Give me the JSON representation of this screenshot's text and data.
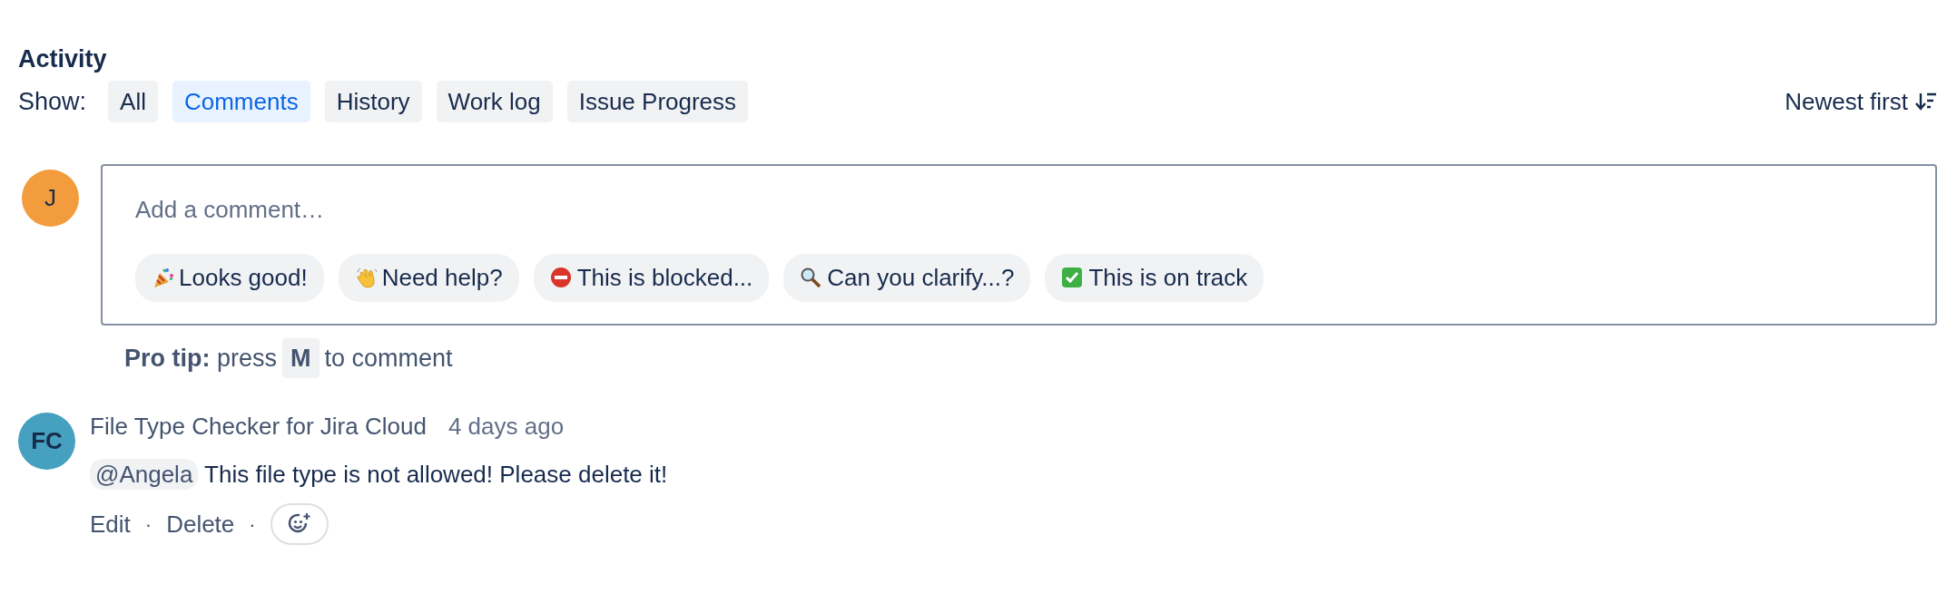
{
  "heading": "Activity",
  "filter": {
    "label": "Show:",
    "tabs": [
      {
        "label": "All",
        "selected": false
      },
      {
        "label": "Comments",
        "selected": true
      },
      {
        "label": "History",
        "selected": false
      },
      {
        "label": "Work log",
        "selected": false
      },
      {
        "label": "Issue Progress",
        "selected": false
      }
    ]
  },
  "sort": {
    "label": "Newest first"
  },
  "composer": {
    "avatar": "J",
    "placeholder": "Add a comment…",
    "quick_replies": [
      {
        "kind": "party",
        "label": "Looks good!"
      },
      {
        "kind": "wave",
        "label": "Need help?"
      },
      {
        "kind": "no-entry",
        "label": "This is blocked..."
      },
      {
        "kind": "magnifier",
        "label": "Can you clarify...?"
      },
      {
        "kind": "check",
        "label": "This is on track"
      }
    ]
  },
  "pro_tip": {
    "label": "Pro tip:",
    "before": "press",
    "key": "M",
    "after": "to comment"
  },
  "comments": [
    {
      "avatar": "FC",
      "author": "File Type Checker for Jira Cloud",
      "time": "4 days ago",
      "mention": "@Angela",
      "text": "This file type is not allowed! Please delete it!",
      "actions": [
        "Edit",
        "Delete"
      ],
      "separator": "·"
    }
  ]
}
